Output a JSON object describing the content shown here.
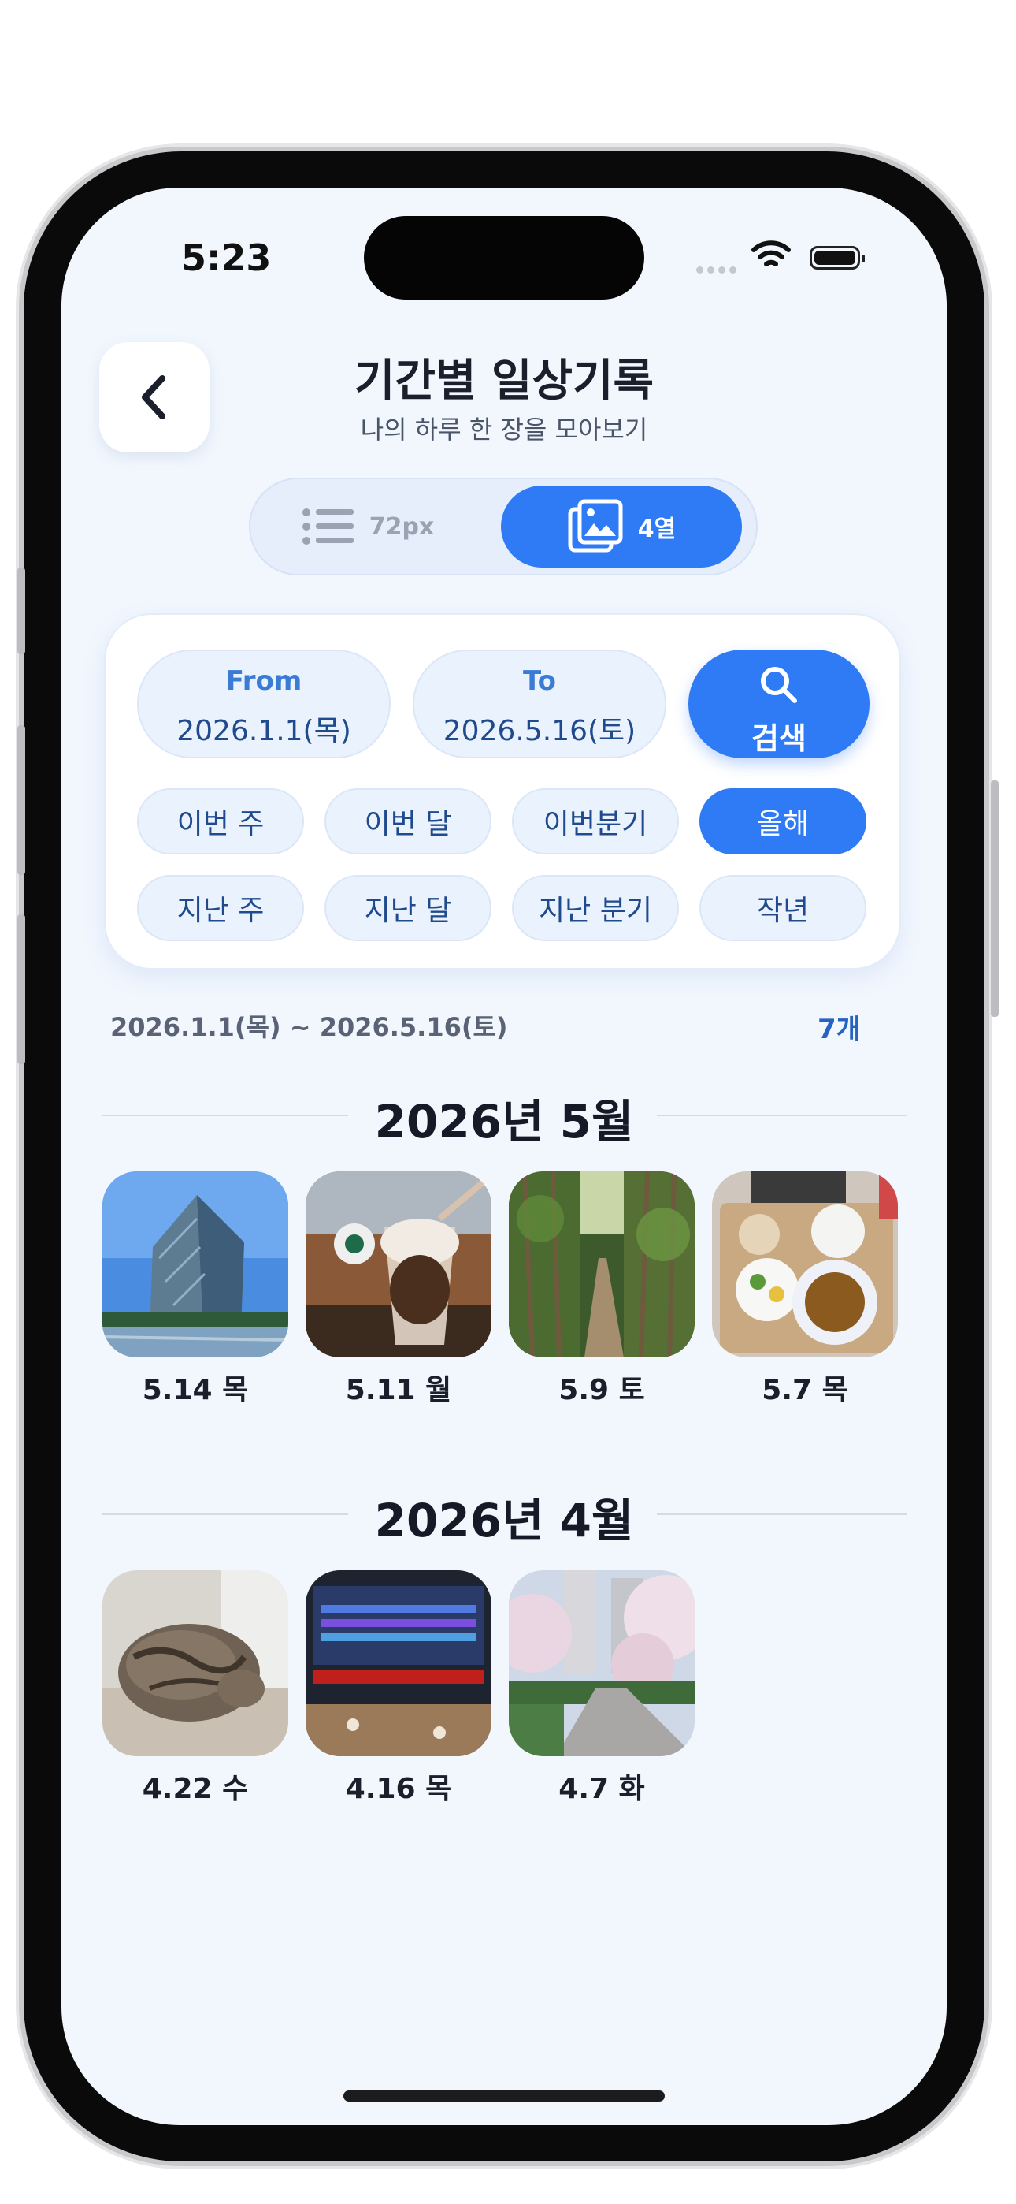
{
  "status": {
    "time": "5:23"
  },
  "header": {
    "title": "기간별 일상기록",
    "subtitle": "나의 하루 한 장을 모아보기"
  },
  "view_toggle": {
    "list_label": "72px",
    "grid_label": "4열",
    "selected": "grid"
  },
  "filter": {
    "from_label": "From",
    "from_value": "2026.1.1(목)",
    "to_label": "To",
    "to_value": "2026.5.16(토)",
    "search_label": "검색",
    "presets": [
      {
        "label": "이번 주"
      },
      {
        "label": "이번 달"
      },
      {
        "label": "이번분기"
      },
      {
        "label": "올해",
        "active": true
      },
      {
        "label": "지난 주"
      },
      {
        "label": "지난 달"
      },
      {
        "label": "지난 분기"
      },
      {
        "label": "작년"
      }
    ]
  },
  "summary": {
    "range": "2026.1.1(목) ~ 2026.5.16(토)",
    "count": "7개"
  },
  "groups": [
    {
      "title": "2026년 5월",
      "items": [
        {
          "caption": "5.14 목",
          "image": "glass-building"
        },
        {
          "caption": "5.11 월",
          "image": "coffee-dessert"
        },
        {
          "caption": "5.9 토",
          "image": "forest-path"
        },
        {
          "caption": "5.7 목",
          "image": "meal-tray"
        }
      ]
    },
    {
      "title": "2026년 4월",
      "items": [
        {
          "caption": "4.22 수",
          "image": "sleeping-cat"
        },
        {
          "caption": "4.16 목",
          "image": "display-board"
        },
        {
          "caption": "4.7 화",
          "image": "cherry-blossom-path"
        }
      ]
    }
  ],
  "colors": {
    "accent": "#2f7bf6",
    "background": "#f2f7fe",
    "chip": "#eaf2fd"
  }
}
